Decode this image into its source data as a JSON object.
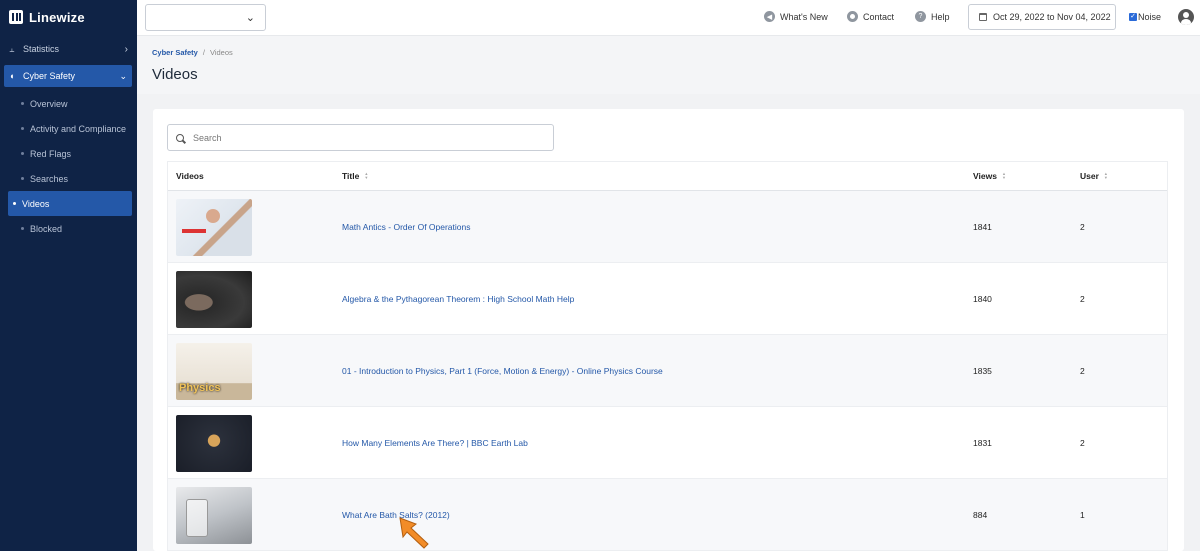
{
  "brand": {
    "name": "Linewize"
  },
  "sidebar": {
    "groups": [
      {
        "label": "Statistics",
        "icon": "chart-icon"
      },
      {
        "label": "Cyber Safety",
        "icon": "shield-icon"
      }
    ],
    "items": [
      {
        "label": "Overview"
      },
      {
        "label": "Activity and Compliance"
      },
      {
        "label": "Red Flags"
      },
      {
        "label": "Searches"
      },
      {
        "label": "Videos",
        "active": true
      },
      {
        "label": "Blocked"
      }
    ]
  },
  "topbar": {
    "whats_new": "What's New",
    "contact": "Contact",
    "help": "Help",
    "date_range": "Oct 29, 2022 to Nov 04, 2022",
    "noise": "Noise"
  },
  "breadcrumb": {
    "parent": "Cyber Safety",
    "current": "Videos"
  },
  "page": {
    "title": "Videos"
  },
  "search": {
    "placeholder": "Search",
    "value": ""
  },
  "table": {
    "headers": {
      "videos": "Videos",
      "title": "Title",
      "views": "Views",
      "user": "User"
    },
    "rows": [
      {
        "title": "Math Antics - Order Of Operations",
        "views": "1841",
        "user": "2"
      },
      {
        "title": "Algebra & the Pythagorean Theorem : High School Math Help",
        "views": "1840",
        "user": "2"
      },
      {
        "title": "01 - Introduction to Physics, Part 1 (Force, Motion & Energy) - Online Physics Course",
        "views": "1835",
        "user": "2"
      },
      {
        "title": "How Many Elements Are There? | BBC Earth Lab",
        "views": "1831",
        "user": "2"
      },
      {
        "title": "What Are Bath Salts? (2012)",
        "views": "884",
        "user": "1"
      }
    ]
  },
  "colors": {
    "sidebar_bg": "#0f2346",
    "accent": "#2458a8",
    "cursor": "#f28c28"
  }
}
